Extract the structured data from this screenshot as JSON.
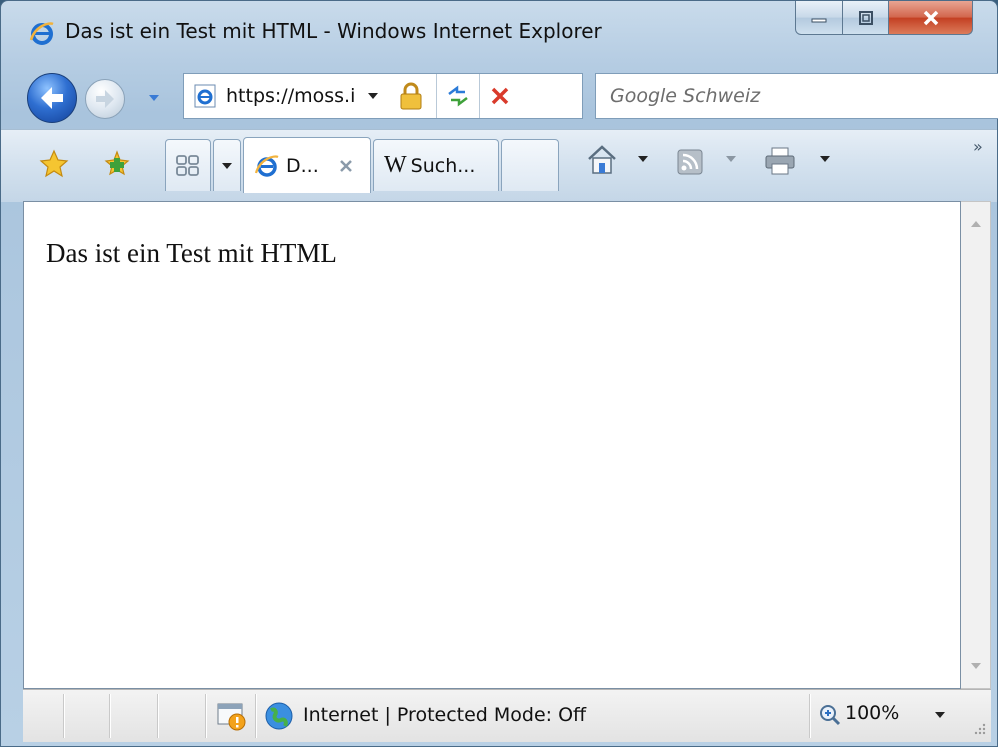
{
  "window": {
    "title": "Das ist ein Test mit HTML - Windows Internet Explorer",
    "caption_buttons": [
      "minimize-icon",
      "restore-icon",
      "close-icon"
    ]
  },
  "navigation": {
    "address": "https://moss.i",
    "search_placeholder": "Google Schweiz",
    "icons": [
      "back-arrow-icon",
      "forward-arrow-icon",
      "ie-page-icon",
      "lock-icon",
      "refresh-icon",
      "stop-icon"
    ]
  },
  "tabs": [
    {
      "label": "D...",
      "icon": "ie-icon",
      "active": true
    },
    {
      "label": "Such...",
      "icon": "wikipedia-icon",
      "active": false
    }
  ],
  "command_bar": {
    "overflow": "»",
    "icons": [
      "favorites-star-icon",
      "add-favorite-icon",
      "quick-tabs-icon",
      "home-icon",
      "feeds-icon",
      "print-icon"
    ]
  },
  "page": {
    "text": "Das ist ein Test mit HTML"
  },
  "status_bar": {
    "zone_text": "Internet | Protected Mode: Off",
    "zoom": "100%"
  },
  "colors": {
    "frame": "#b8d0e5",
    "close_button": "#c33f22",
    "content_background": "#ffffff"
  }
}
